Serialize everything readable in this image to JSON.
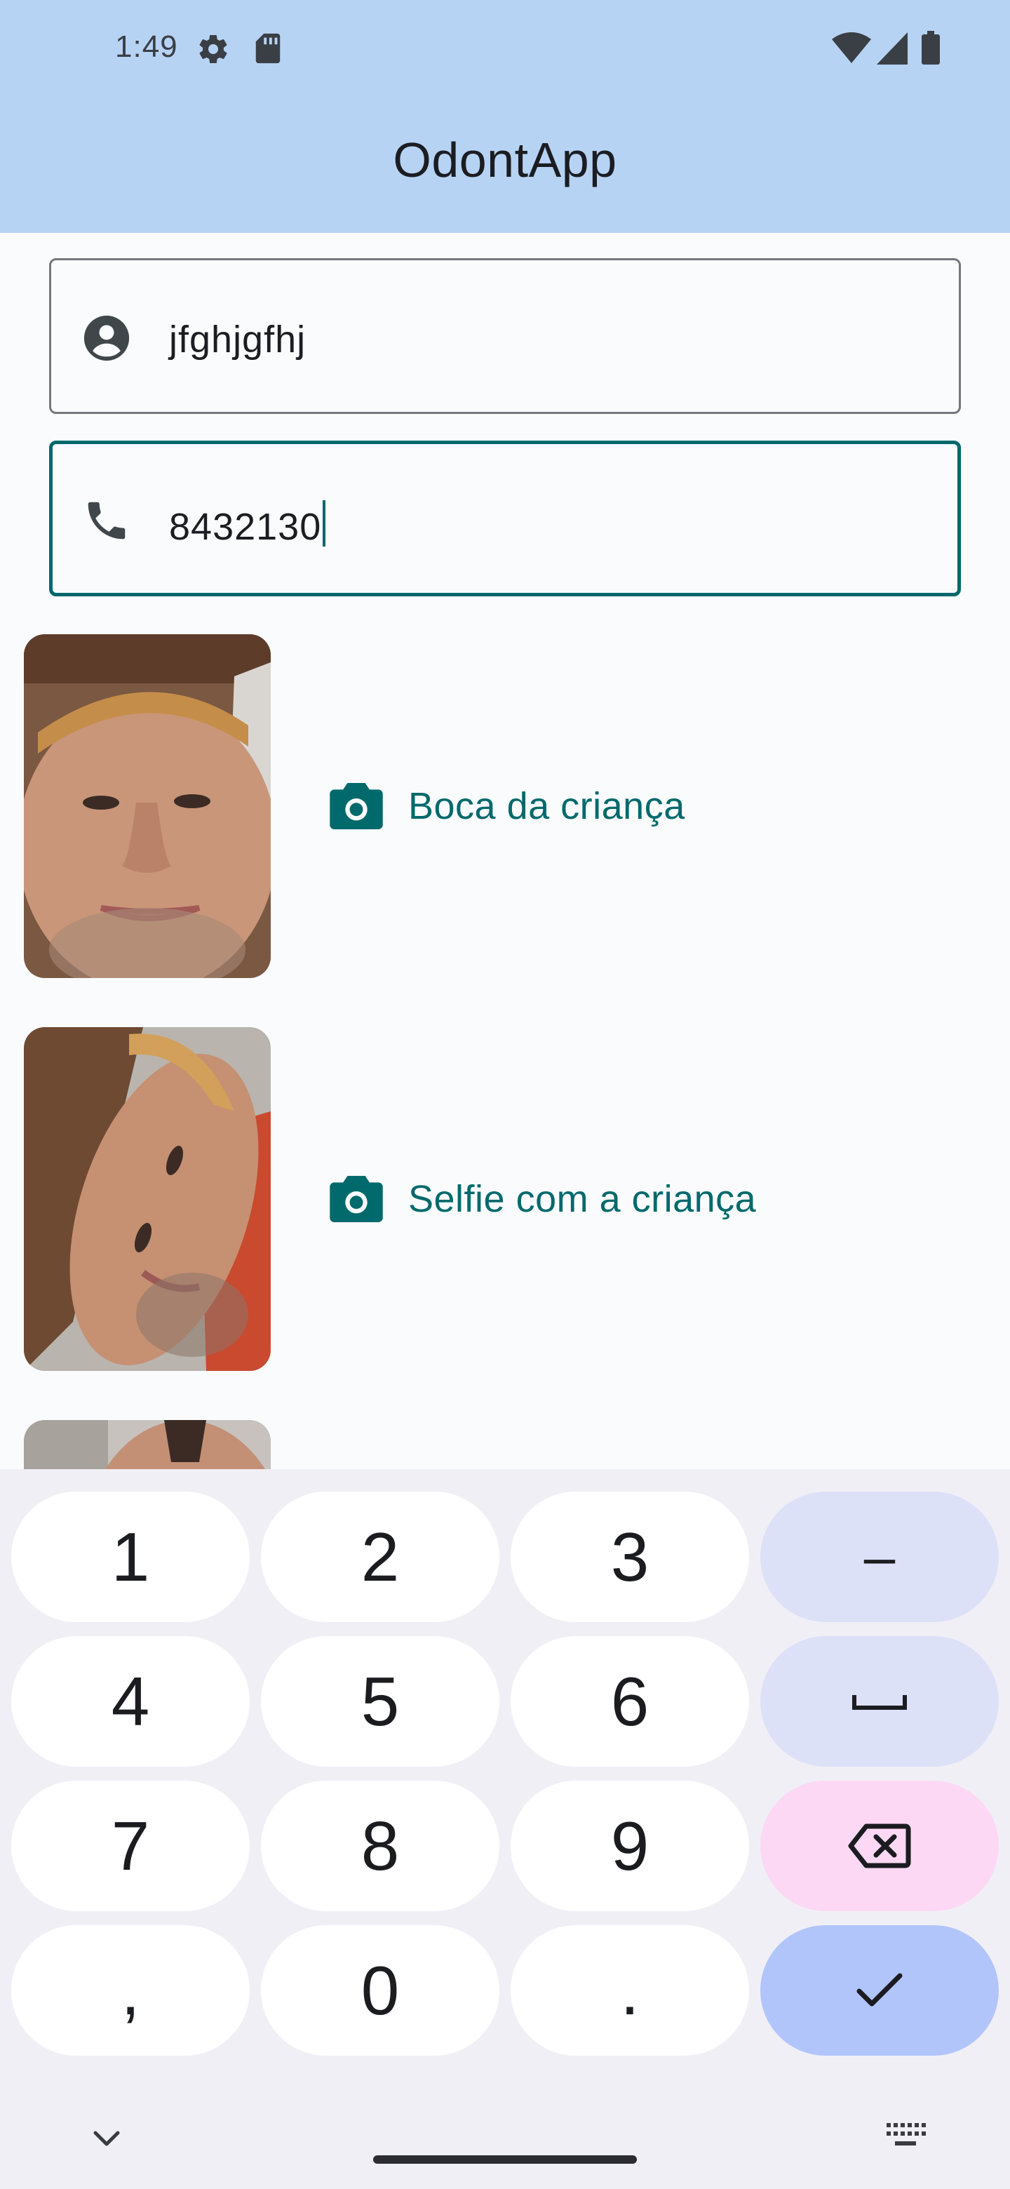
{
  "status_bar": {
    "time": "1:49",
    "icons": [
      "gear-icon",
      "sd-card-icon",
      "wifi-icon",
      "signal-icon",
      "battery-icon"
    ]
  },
  "app_bar": {
    "title": "OdontApp",
    "color": "#b7d3f4"
  },
  "form": {
    "name_field": {
      "icon": "person-circle-icon",
      "value": "jfghjgfhj"
    },
    "phone_field": {
      "icon": "phone-icon",
      "value": "8432130",
      "focused": true
    },
    "accent_color": "#00686b"
  },
  "photos": [
    {
      "icon": "camera-icon",
      "label": "Boca da criança"
    },
    {
      "icon": "camera-icon",
      "label": "Selfie com a criança"
    },
    {
      "icon": "camera-icon",
      "label": ""
    }
  ],
  "keyboard": {
    "rows": [
      [
        "1",
        "2",
        "3",
        "–"
      ],
      [
        "4",
        "5",
        "6",
        "space"
      ],
      [
        "7",
        "8",
        "9",
        "backspace"
      ],
      [
        ",",
        "0",
        ".",
        "done"
      ]
    ],
    "keys": {
      "k1": "1",
      "k2": "2",
      "k3": "3",
      "dash": "–",
      "k4": "4",
      "k5": "5",
      "k6": "6",
      "k7": "7",
      "k8": "8",
      "k9": "9",
      "comma": ",",
      "k0": "0",
      "period": "."
    },
    "icons": [
      "space-icon",
      "backspace-icon",
      "checkmark-icon",
      "chevron-down-icon",
      "keyboard-icon"
    ]
  }
}
